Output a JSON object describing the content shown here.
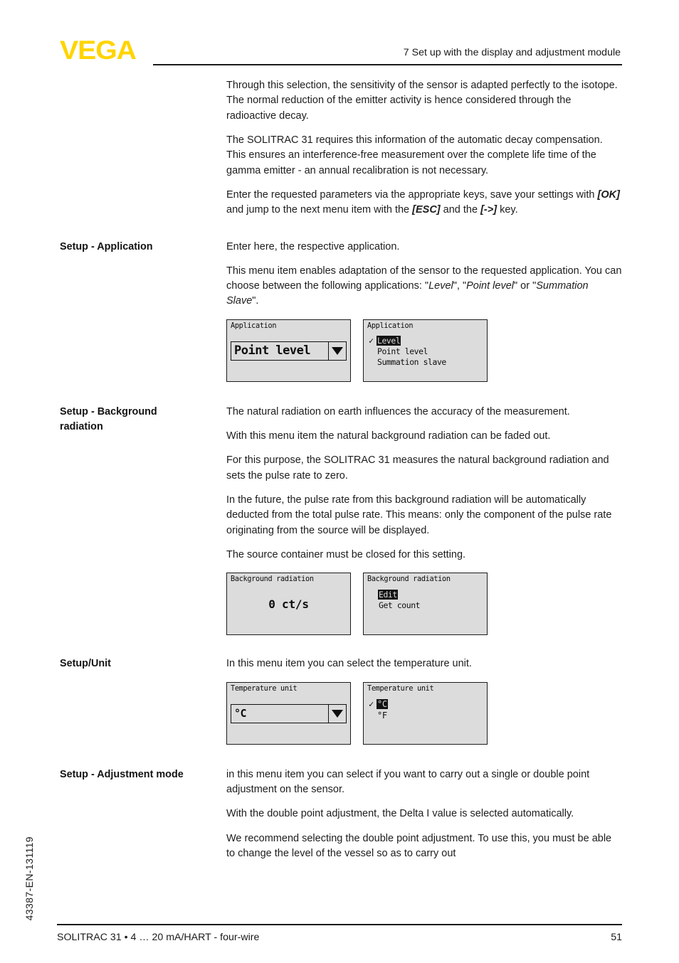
{
  "header": {
    "logo_text": "VEGA",
    "logo_color": "#FFD400",
    "chapter_title": "7 Set up with the display and adjustment module"
  },
  "footer": {
    "document_line": "SOLITRAC 31 • 4 … 20 mA/HART - four-wire",
    "page_number": "51",
    "side_code": "43387-EN-131119"
  },
  "intro": {
    "p1": "Through this selection, the sensitivity of the sensor is adapted perfectly to the isotope. The normal reduction of the emitter activity is hence considered through the radioactive decay.",
    "p2": "The SOLITRAC 31 requires this information of the automatic decay compensation. This ensures an interference-free measurement over the complete life time of the gamma emitter - an annual recalibration is not necessary.",
    "p3_a": "Enter the requested parameters via the appropriate keys, save your settings with ",
    "p3_ok": "[OK]",
    "p3_b": " and jump to the next menu item with the ",
    "p3_esc": "[ESC]",
    "p3_c": " and the ",
    "p3_arrow": "[->]",
    "p3_d": " key."
  },
  "sections": [
    {
      "label": "Setup - Application",
      "p1": "Enter here, the respective application.",
      "p2_a": "This menu item enables adaptation of the sensor to the requested application. You can choose between the following applications: \"",
      "p2_i1": "Level",
      "p2_b": "\", \"",
      "p2_i2": "Point level",
      "p2_c": "\" or \"",
      "p2_i3": "Summation Slave",
      "p2_d": "\"."
    },
    {
      "label_line1": "Setup - Background",
      "label_line2": "radiation",
      "p1": "The natural radiation on earth influences the accuracy of the measurement.",
      "p2": "With this menu item the natural background radiation can be faded out.",
      "p3": "For this purpose, the SOLITRAC 31 measures the natural background radiation and sets the pulse rate to zero.",
      "p4": "In the future, the pulse rate from this background radiation will be automatically deducted from the total pulse rate. This means: only the component of the pulse rate originating from the source will be displayed.",
      "p5": "The source container must be closed for this setting."
    },
    {
      "label": "Setup/Unit",
      "p1": "In this menu item you can select the temperature unit."
    },
    {
      "label": "Setup - Adjustment mode",
      "p1": "in this menu item you can select if you want to carry out a single or double point adjustment on the sensor.",
      "p2": "With the double point adjustment, the Delta I value is selected automatically.",
      "p3": "We recommend selecting the double point adjustment. To use this, you must be able to change the level of the vessel so as to carry out"
    }
  ],
  "lcd": {
    "application_left": {
      "title": "Application",
      "value": "Point level",
      "arrow_icon": "chevron-down-icon"
    },
    "application_right": {
      "title": "Application",
      "options": [
        {
          "text": "Level",
          "selected": true,
          "check": "✓"
        },
        {
          "text": "Point level",
          "selected": false,
          "check": ""
        },
        {
          "text": "Summation slave",
          "selected": false,
          "check": ""
        }
      ]
    },
    "background_left": {
      "title": "Background radiation",
      "value": "0 ct/s"
    },
    "background_right": {
      "title": "Background radiation",
      "options": [
        {
          "text": "Edit",
          "selected": true,
          "check": ""
        },
        {
          "text": "Get count",
          "selected": false,
          "check": ""
        }
      ]
    },
    "unit_left": {
      "title": "Temperature unit",
      "value": "°C",
      "arrow_icon": "chevron-down-icon"
    },
    "unit_right": {
      "title": "Temperature unit",
      "options": [
        {
          "text": "°C",
          "selected": true,
          "check": "✓"
        },
        {
          "text": "°F",
          "selected": false,
          "check": ""
        }
      ]
    }
  }
}
